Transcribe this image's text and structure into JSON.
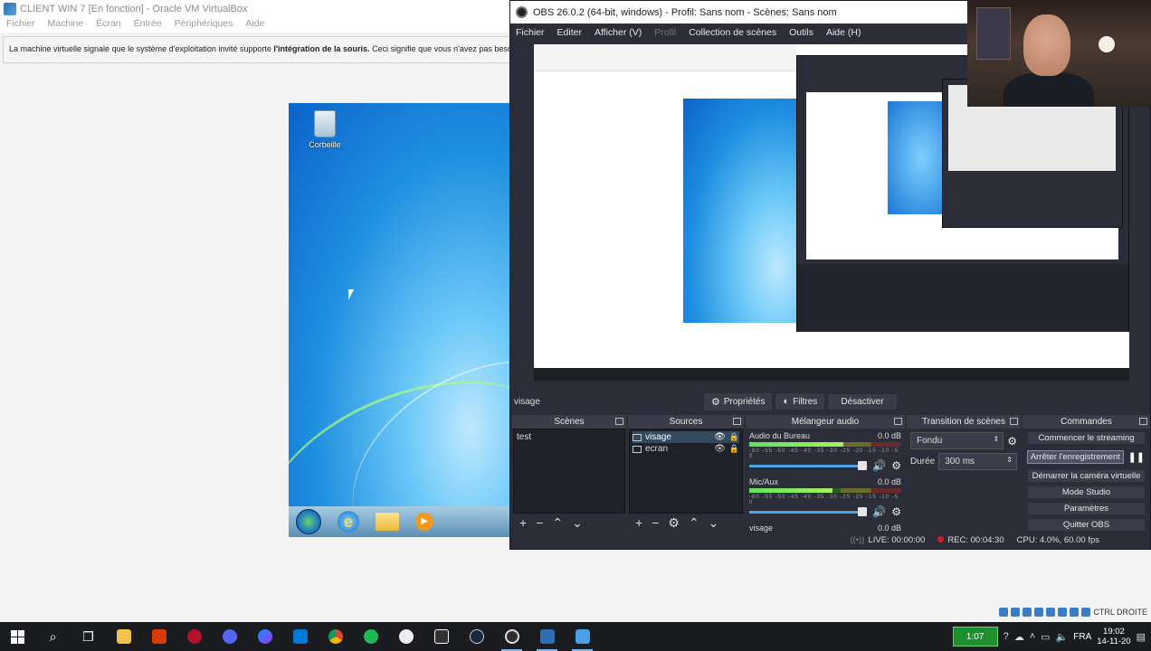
{
  "vbox": {
    "title": "CLIENT WIN 7 [En fonction] - Oracle VM VirtualBox",
    "menu": [
      "Fichier",
      "Machine",
      "Écran",
      "Entrée",
      "Périphériques",
      "Aide"
    ],
    "notice_prefix": "La machine virtuelle signale que le système d'exploitation invité supporte ",
    "notice_bold": "l'intégration de la souris.",
    "notice_suffix": " Ceci signifie que vous n'avez pas besoin de",
    "host_key_label": "CTRL DROITE"
  },
  "guest": {
    "recycle_label": "Corbeille",
    "taskbar_media_glyph": "▶"
  },
  "obs": {
    "title": "OBS 26.0.2 (64-bit, windows) - Profil: Sans nom - Scènes: Sans nom",
    "menu": [
      "Fichier",
      "Editer",
      "Afficher (V)",
      "Profil",
      "Collection de scènes",
      "Outils",
      "Aide (H)"
    ],
    "selected_source": "visage",
    "properties_label": "Propriétés",
    "filters_label": "Filtres",
    "disable_label": "Désactiver",
    "docks": {
      "scenes": {
        "title": "Scènes",
        "items": [
          "test"
        ]
      },
      "sources": {
        "title": "Sources",
        "items": [
          "visage",
          "ecran"
        ]
      },
      "mixer": {
        "title": "Mélangeur audio",
        "channels": [
          {
            "name": "Audio du Bureau",
            "db": "0.0 dB",
            "level": 0.62
          },
          {
            "name": "Mic/Aux",
            "db": "0.0 dB",
            "level": 0.55
          },
          {
            "name": "visage",
            "db": "0.0 dB",
            "level": 0.0
          }
        ],
        "scale": "-60 -55 -50 -45 -40 -35 -30 -25 -20 -15 -10 -5 0"
      },
      "transitions": {
        "title": "Transition de scènes",
        "type": "Fondu",
        "duration_label": "Durée",
        "duration": "300 ms"
      },
      "commands": {
        "title": "Commandes",
        "buttons": [
          "Commencer le streaming",
          "Arrêter l'enregistrement",
          "Démarrer la caméra virtuelle",
          "Mode Studio",
          "Paramètres",
          "Quitter OBS"
        ]
      }
    },
    "status": {
      "live": "LIVE: 00:00:00",
      "rec": "REC: 00:04:30",
      "cpu": "CPU: 4.0%, 60.00 fps"
    },
    "colors": {
      "bg": "#2b2e38",
      "panel": "#1f2128",
      "accent": "#4fa3e3"
    }
  },
  "taskbar": {
    "apps": [
      "search-icon",
      "task-view-icon",
      "file-explorer-icon",
      "office-icon",
      "red-app-icon",
      "discord-icon",
      "messenger-icon",
      "mail-icon",
      "chrome-icon",
      "spotify-icon",
      "vpn-icon",
      "epic-games-icon",
      "steam-icon",
      "obs-icon",
      "virtualbox-icon",
      "vbox-vm-icon"
    ],
    "battery_text": "1:07",
    "language": "FRA",
    "time": "19:02",
    "date": "14-11-20"
  }
}
